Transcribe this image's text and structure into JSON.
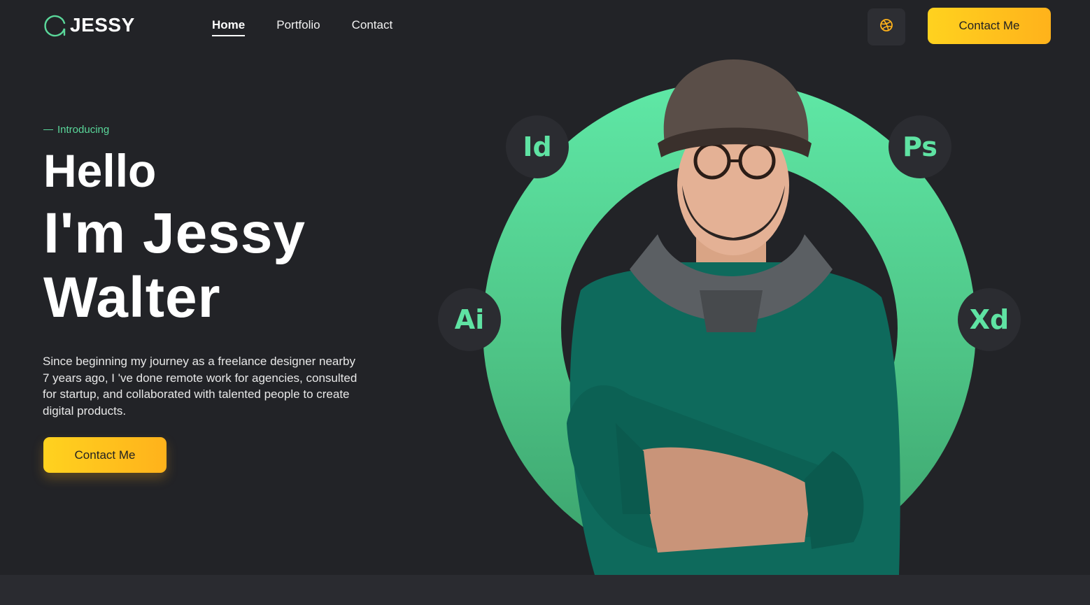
{
  "brand": {
    "name": "JESSY",
    "icon": "logo-g-icon",
    "accent": "#5ad79a"
  },
  "nav": [
    {
      "label": "Home",
      "active": true
    },
    {
      "label": "Portfolio",
      "active": false
    },
    {
      "label": "Contact",
      "active": false
    }
  ],
  "header": {
    "social_icon": "dribbble-icon",
    "cta_label": "Contact Me"
  },
  "hero": {
    "kicker": "Introducing",
    "hello": "Hello",
    "name_line1": "I'm Jessy",
    "name_line2": "Walter",
    "description": "Since beginning my journey as a freelance designer nearby 7 years ago, I 've done remote work for agencies, consulted for startup, and collaborated with talented people to create digital products.",
    "cta_label": "Contact Me",
    "cta_color": "#ffc21d"
  },
  "tools": [
    {
      "label": "Id"
    },
    {
      "label": "Ps"
    },
    {
      "label": "Ai"
    },
    {
      "label": "Xd"
    }
  ],
  "colors": {
    "background": "#222327",
    "ring": "#55d495",
    "button": "#ffc21d"
  }
}
